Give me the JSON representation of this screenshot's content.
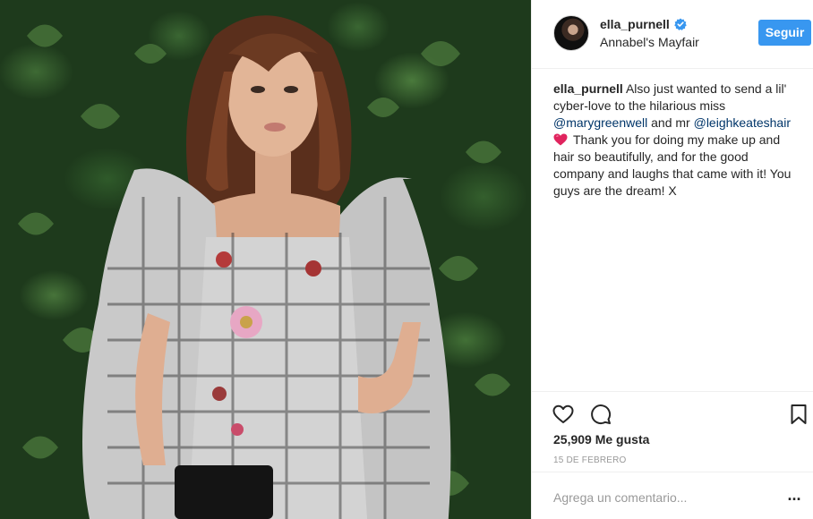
{
  "header": {
    "username": "ella_purnell",
    "location": "Annabel's Mayfair",
    "follow_label": "Seguir"
  },
  "caption": {
    "username": "ella_purnell",
    "text_1": "Also just wanted to send a lil' cyber-love to the hilarious miss",
    "mention_1": "@marygreenwell",
    "text_2": "and mr",
    "mention_2": "@leighkeateshair",
    "emoji": "heart-emoji",
    "text_3": "Thank you for doing my make up and hair so beautifully, and for the good company and laughs that came with it! You guys are the dream! X"
  },
  "stats": {
    "likes": "25,909 Me gusta",
    "date": "15 de febrero"
  },
  "comment": {
    "placeholder": "Agrega un comentario...",
    "more_label": "..."
  },
  "colors": {
    "accent": "#3897f0",
    "mention": "#003569",
    "emoji_heart": "#e0245e"
  }
}
